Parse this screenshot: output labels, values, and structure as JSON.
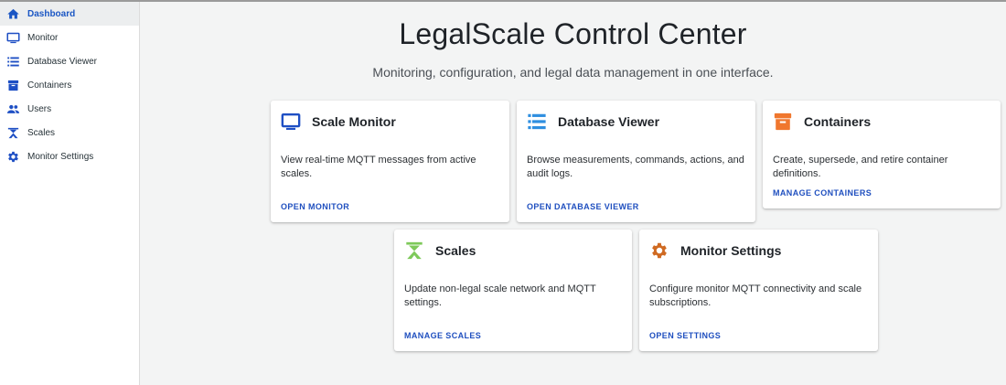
{
  "sidebar": {
    "items": [
      {
        "label": "Dashboard",
        "icon": "home-icon",
        "active": true
      },
      {
        "label": "Monitor",
        "icon": "monitor-icon"
      },
      {
        "label": "Database Viewer",
        "icon": "database-icon"
      },
      {
        "label": "Containers",
        "icon": "archive-icon"
      },
      {
        "label": "Users",
        "icon": "users-icon"
      },
      {
        "label": "Scales",
        "icon": "scale-icon"
      },
      {
        "label": "Monitor Settings",
        "icon": "gear-icon"
      }
    ]
  },
  "main": {
    "title": "LegalScale Control Center",
    "subtitle": "Monitoring, configuration, and legal data management in one interface.",
    "cards": [
      {
        "title": "Scale Monitor",
        "description": "View real-time MQTT messages from active scales.",
        "action": "OPEN MONITOR",
        "icon": "monitor-icon"
      },
      {
        "title": "Database Viewer",
        "description": "Browse measurements, commands, actions, and audit logs.",
        "action": "OPEN DATABASE VIEWER",
        "icon": "database-icon"
      },
      {
        "title": "Containers",
        "description": "Create, supersede, and retire container definitions.",
        "action": "MANAGE CONTAINERS",
        "icon": "archive-icon"
      },
      {
        "title": "Scales",
        "description": "Update non-legal scale network and MQTT settings.",
        "action": "MANAGE SCALES",
        "icon": "scale-icon"
      },
      {
        "title": "Monitor Settings",
        "description": "Configure monitor MQTT connectivity and scale subscriptions.",
        "action": "OPEN SETTINGS",
        "icon": "gear-icon"
      }
    ]
  },
  "colors": {
    "accent": "#1a56c4",
    "monitor_icon": "#1e4fc4",
    "database_icon": "#2f8fe0",
    "containers_icon": "#f0772e",
    "scales_icon": "#7ec95a",
    "settings_icon": "#cf6a22"
  }
}
